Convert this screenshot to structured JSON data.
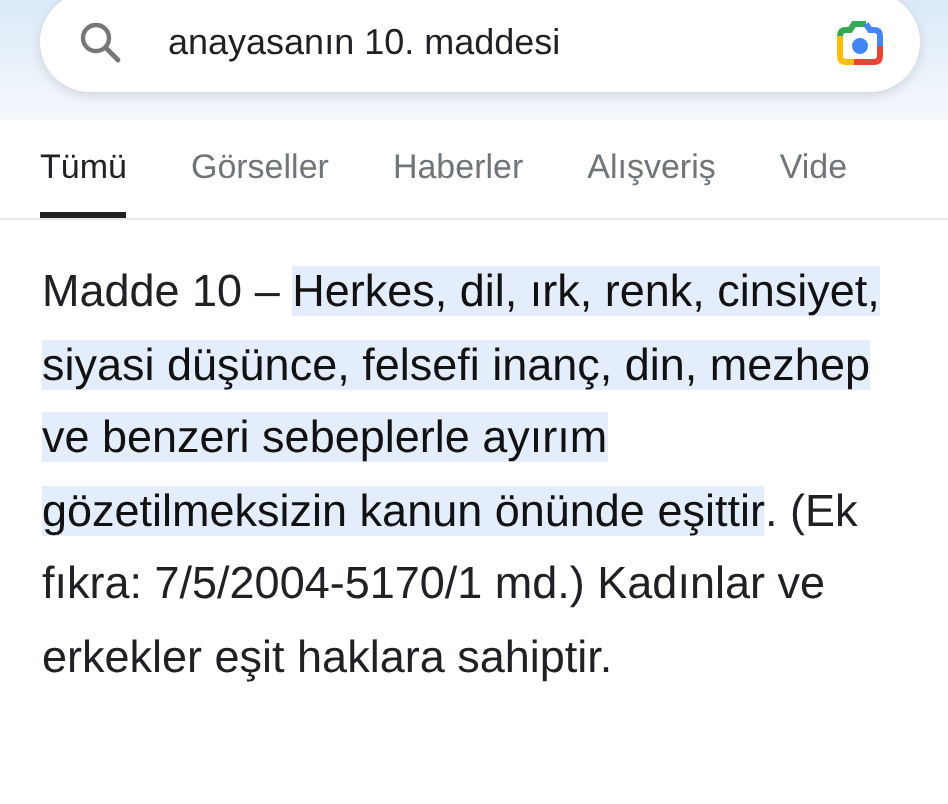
{
  "search": {
    "value": "anayasanın 10. maddesi"
  },
  "tabs": [
    {
      "label": "Tümü",
      "selected": true
    },
    {
      "label": "Görseller",
      "selected": false
    },
    {
      "label": "Haberler",
      "selected": false
    },
    {
      "label": "Alışveriş",
      "selected": false
    },
    {
      "label": "Vide",
      "selected": false
    }
  ],
  "snippet": "Madde 10 – **Herkes, dil, ırk, renk, cinsiyet, siyasi düşünce, felsefi inanç, din, mezhep ve benzeri sebeplerle ayırım gözetilmeksizin kanun önünde eşittir**. (Ek fıkra: 7/5/2004-5170/1 md.) Kadınlar ve erkekler eşit haklara sahiptir."
}
